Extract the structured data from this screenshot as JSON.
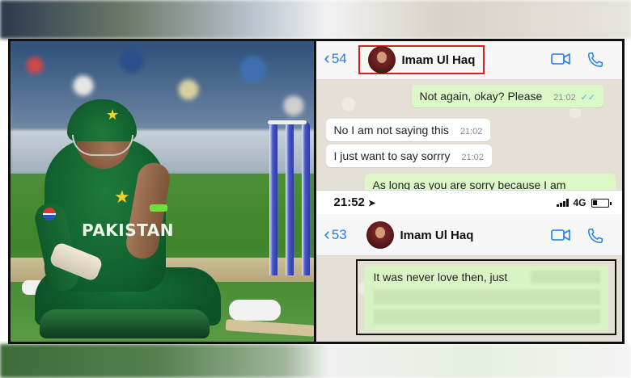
{
  "chat_top": {
    "back_count": "54",
    "contact_name": "Imam Ul Haq",
    "messages": [
      {
        "text": "Not again, okay? Please",
        "time": "21:02",
        "direction": "out",
        "ticks": "✓✓"
      },
      {
        "text": "No I am not saying this",
        "time": "21:02",
        "direction": "in"
      },
      {
        "text": "I just want to say sorrry",
        "time": "21:02",
        "direction": "in"
      },
      {
        "text": "As long as you are sorry because I am",
        "direction": "out"
      }
    ]
  },
  "status_bar": {
    "time": "21:52",
    "network": "4G"
  },
  "chat_bottom": {
    "back_count": "53",
    "contact_name": "Imam Ul Haq",
    "message_visible_text": "It was never love then, just"
  },
  "photo": {
    "jersey_text": "PAKISTAN",
    "sponsor_icon": "pepsi-logo-icon"
  },
  "colors": {
    "ios_blue": "#1e7df5",
    "outgoing_bubble": "#dcf8c6",
    "incoming_bubble": "#ffffff",
    "highlight_red": "#d22222",
    "jersey_green": "#126530"
  }
}
